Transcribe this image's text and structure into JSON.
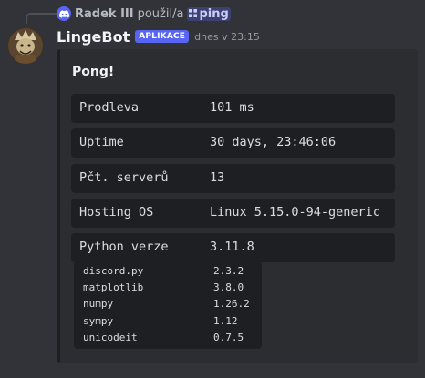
{
  "reply": {
    "user": "Radek III",
    "action": "použil/a",
    "command": "ping",
    "command_icon": "slash-command-icon"
  },
  "author": {
    "name": "LingeBot",
    "tag": "APLIKACE",
    "timestamp": "dnes v 23:15"
  },
  "embed": {
    "title": "Pong!",
    "fields": [
      {
        "key": "Prodleva",
        "value": "101 ms"
      },
      {
        "key": "Uptime",
        "value": "30 days, 23:46:06"
      },
      {
        "key": "Pčt. serverů",
        "value": "13"
      },
      {
        "key": "Hosting OS",
        "value": "Linux 5.15.0-94-generic"
      },
      {
        "key": "Python verze",
        "value": "3.11.8"
      }
    ],
    "libraries": [
      {
        "name": "discord.py",
        "version": "2.3.2"
      },
      {
        "name": "matplotlib",
        "version": "3.8.0"
      },
      {
        "name": "numpy",
        "version": "1.26.2"
      },
      {
        "name": "sympy",
        "version": "1.12"
      },
      {
        "name": "unicodeit",
        "version": "0.7.5"
      }
    ]
  },
  "colors": {
    "background": "#313338",
    "embed": "#2b2d31",
    "code_block": "#1e1f22",
    "blurple": "#5865f2",
    "text": "#dbdee1"
  }
}
